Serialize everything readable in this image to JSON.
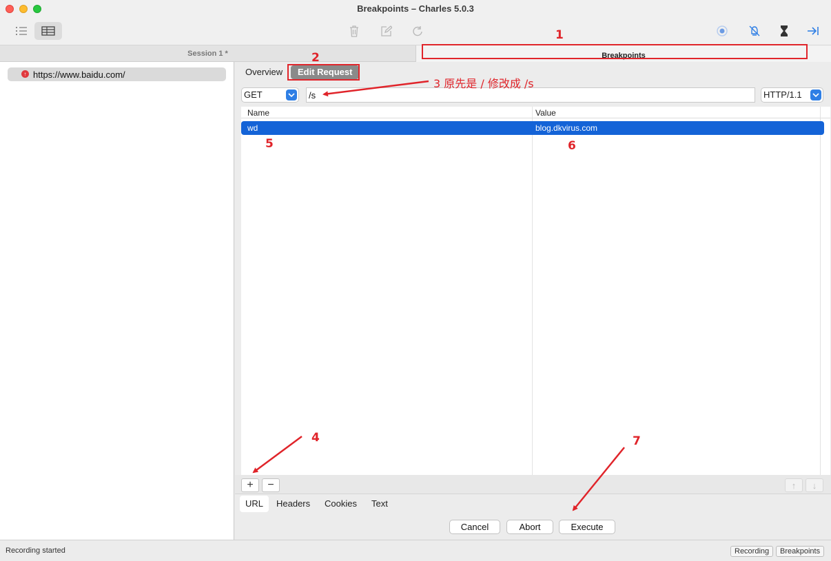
{
  "window": {
    "title": "Breakpoints – Charles 5.0.3"
  },
  "tabs": {
    "session": "Session 1 *",
    "breakpoints": "Breakpoints"
  },
  "sidebar": {
    "items": [
      {
        "label": "https://www.baidu.com/",
        "icon": "breakpoint-icon"
      }
    ]
  },
  "editor": {
    "subtabs": {
      "overview": "Overview",
      "edit_request": "Edit Request"
    },
    "method": "GET",
    "path": "/s",
    "protocol": "HTTP/1.1",
    "columns": {
      "name": "Name",
      "value": "Value"
    },
    "rows": [
      {
        "name": "wd",
        "value": "blog.dkvirus.com"
      }
    ],
    "add_label": "+",
    "remove_label": "−",
    "up_label": "↑",
    "down_label": "↓",
    "bottom_tabs": [
      "URL",
      "Headers",
      "Cookies",
      "Text"
    ],
    "actions": {
      "cancel": "Cancel",
      "abort": "Abort",
      "execute": "Execute"
    }
  },
  "status": {
    "text": "Recording started",
    "recording": "Recording",
    "breakpoints": "Breakpoints"
  },
  "annotations": {
    "n1": "1",
    "n2": "2",
    "n4": "4",
    "n5": "5",
    "n6": "6",
    "n7": "7",
    "note3": "3 原先是 / 修改成 /s"
  },
  "colors": {
    "accent": "#1463d7",
    "annotation": "#e0242a",
    "close": "#ff5f57",
    "minimize": "#febc2e",
    "zoom": "#28c840"
  }
}
